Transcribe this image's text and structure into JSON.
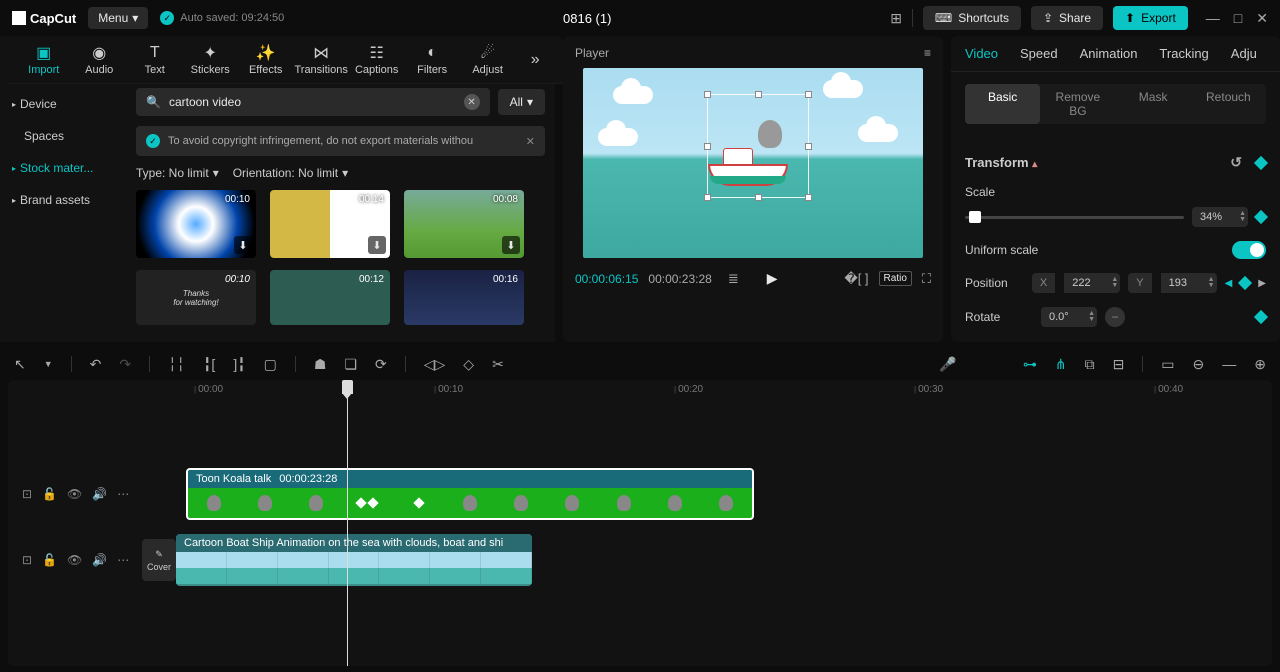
{
  "app": {
    "name": "CapCut",
    "menu_label": "Menu",
    "autosave": "Auto saved: 09:24:50",
    "title": "0816 (1)"
  },
  "top_actions": {
    "shortcuts": "Shortcuts",
    "share": "Share",
    "export": "Export"
  },
  "tabs": [
    "Import",
    "Audio",
    "Text",
    "Stickers",
    "Effects",
    "Transitions",
    "Captions",
    "Filters",
    "Adjust"
  ],
  "import_sidebar": {
    "device": "Device",
    "spaces": "Spaces",
    "stock": "Stock mater...",
    "brand": "Brand assets"
  },
  "search": {
    "value": "cartoon video",
    "all": "All"
  },
  "warning": "To avoid copyright infringement, do not export materials withou",
  "filters": {
    "type": "Type: No limit",
    "orient": "Orientation: No limit"
  },
  "thumbs": {
    "d1": "00:10",
    "d2": "00:14",
    "d3": "00:08",
    "d4": "00:10",
    "d5": "00:12",
    "d6": "00:16",
    "thanks": "Thanks\nfor watching!"
  },
  "player": {
    "label": "Player",
    "current": "00:00:06:15",
    "duration": "00:00:23:28",
    "ratio": "Ratio"
  },
  "props": {
    "tabs": {
      "video": "Video",
      "speed": "Speed",
      "animation": "Animation",
      "tracking": "Tracking",
      "adjust": "Adju"
    },
    "subtabs": {
      "basic": "Basic",
      "removebg": "Remove BG",
      "mask": "Mask",
      "retouch": "Retouch"
    },
    "transform": "Transform",
    "scale": {
      "label": "Scale",
      "value": "34%"
    },
    "uniform": "Uniform scale",
    "position": {
      "label": "Position",
      "x": "222",
      "y": "193"
    },
    "rotate": {
      "label": "Rotate",
      "value": "0.0°"
    }
  },
  "ruler": [
    "00:00",
    "00:10",
    "00:20",
    "00:30",
    "00:40"
  ],
  "clips": {
    "c1_name": "Toon Koala talk",
    "c1_dur": "00:00:23:28",
    "c2_name": "Cartoon Boat Ship Animation on the sea with clouds, boat and shi",
    "cover": "Cover"
  }
}
